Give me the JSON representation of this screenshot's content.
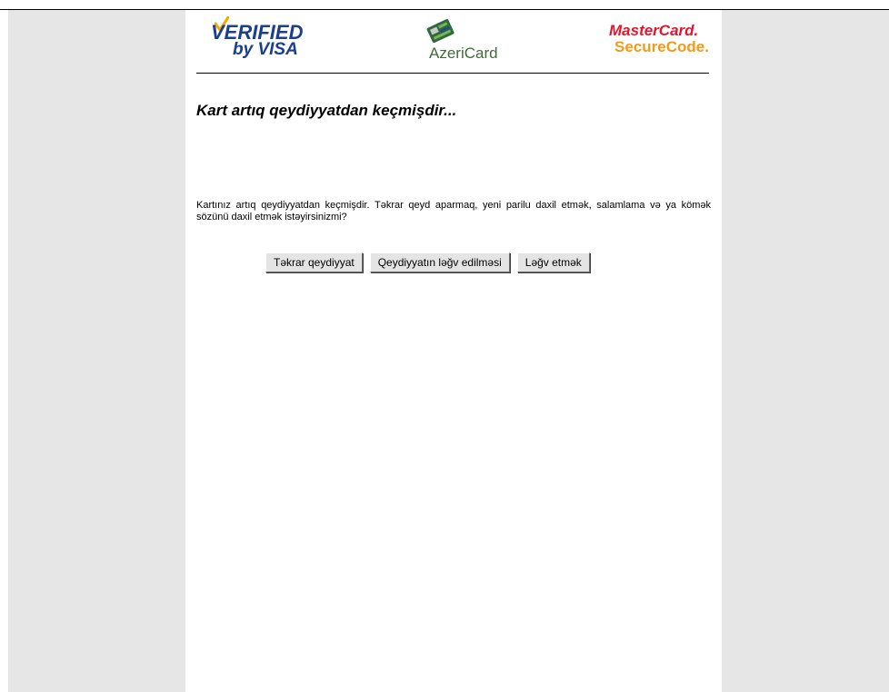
{
  "header": {
    "visa_logo": {
      "line1": "VERIFIED",
      "line2": "by VISA",
      "icon": "check-swoosh-icon",
      "color": "#1b3f8b"
    },
    "azericard_logo": {
      "text": "AzeriCard",
      "icon": "card-emblem-icon",
      "color": "#3f6a3a"
    },
    "mastercard_logo": {
      "line1": "MasterCard.",
      "line2": "SecureCode.",
      "colors": [
        "#e3162d",
        "#f39b17"
      ]
    }
  },
  "main": {
    "title": "Kart artıq qeydiyyatdan keçmişdir...",
    "message": "Kartınız artıq qeydiyyatdan keçmişdir. Təkrar qeyd aparmaq, yeni parilu daxil etmək, salamlama və ya kömək sözünü daxil etmək istəyirsinizmi?"
  },
  "buttons": {
    "reregister": "Təkrar qeydiyyat",
    "cancel_registration": "Qeydiyyatın ləğv edilməsi",
    "cancel": "Ləğv etmək"
  },
  "colors": {
    "page_background": "#e6e6e6",
    "panel_background": "#ffffff"
  }
}
